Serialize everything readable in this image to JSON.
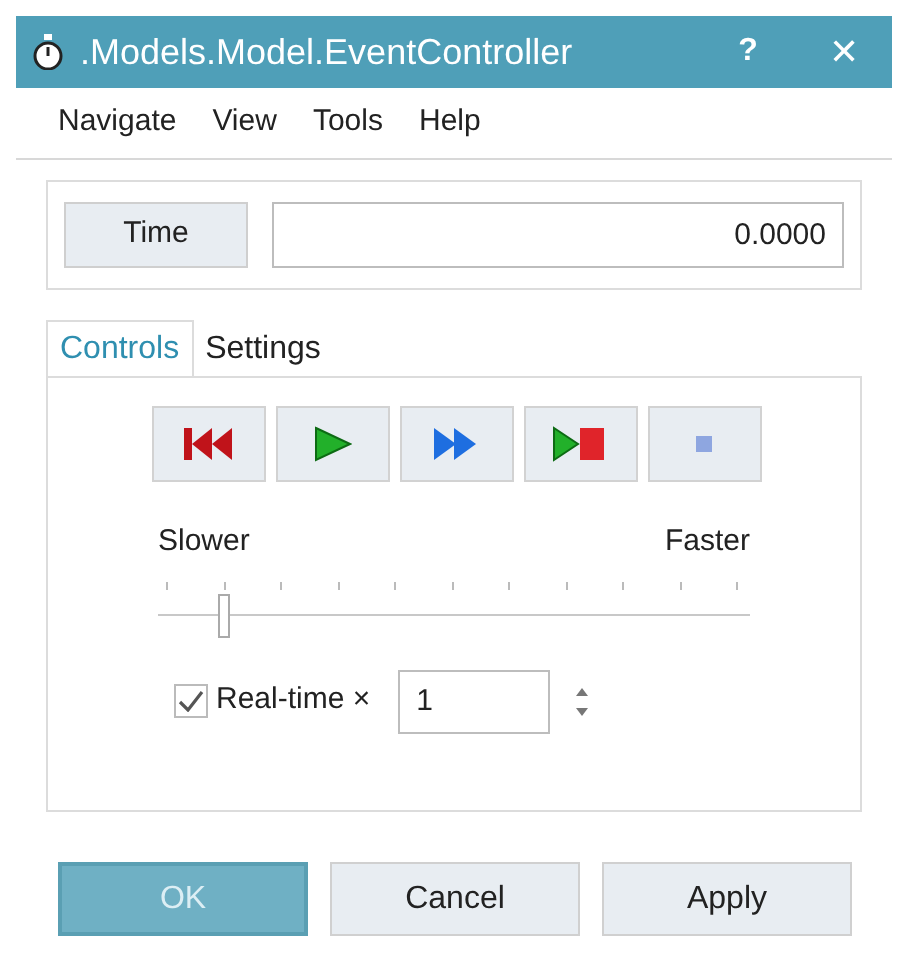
{
  "window": {
    "title": ".Models.Model.EventController",
    "help": "?",
    "close": "✕"
  },
  "menu": [
    "Navigate",
    "View",
    "Tools",
    "Help"
  ],
  "time": {
    "label": "Time",
    "value": "0.0000"
  },
  "tabs": [
    {
      "label": "Controls",
      "selected": true
    },
    {
      "label": "Settings",
      "selected": false
    }
  ],
  "media_buttons": [
    {
      "kind": "rewind"
    },
    {
      "kind": "play"
    },
    {
      "kind": "fast_forward"
    },
    {
      "kind": "play_stop"
    },
    {
      "kind": "stop"
    }
  ],
  "speed": {
    "min_label": "Slower",
    "max_label": "Faster",
    "level": 0.1
  },
  "realtime": {
    "label": "Real-time ×",
    "checked": true,
    "value": "1"
  },
  "buttons": [
    {
      "label": "OK",
      "selected": true
    },
    {
      "label": "Cancel",
      "selected": false
    },
    {
      "label": "Apply",
      "selected": false
    }
  ]
}
